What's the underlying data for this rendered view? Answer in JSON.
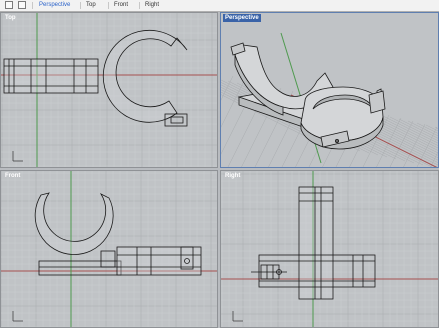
{
  "toolbar": {
    "tabs": [
      {
        "label": "Perspective",
        "active": true
      },
      {
        "label": "Top",
        "active": false
      },
      {
        "label": "Front",
        "active": false
      },
      {
        "label": "Right",
        "active": false
      }
    ]
  },
  "viewports": {
    "top": {
      "title": "Top"
    },
    "perspective": {
      "title": "Perspective"
    },
    "front": {
      "title": "Front"
    },
    "right": {
      "title": "Right"
    }
  },
  "colors": {
    "background": "#c0c3c6",
    "grid_minor": "#cbced1",
    "grid_major": "#a9acaf",
    "x_axis": "#a65050",
    "y_axis": "#4e9a4e",
    "active_title": "#3a63a8",
    "active_tab": "#2a62c9",
    "model_fill": "#d4d6d8"
  }
}
